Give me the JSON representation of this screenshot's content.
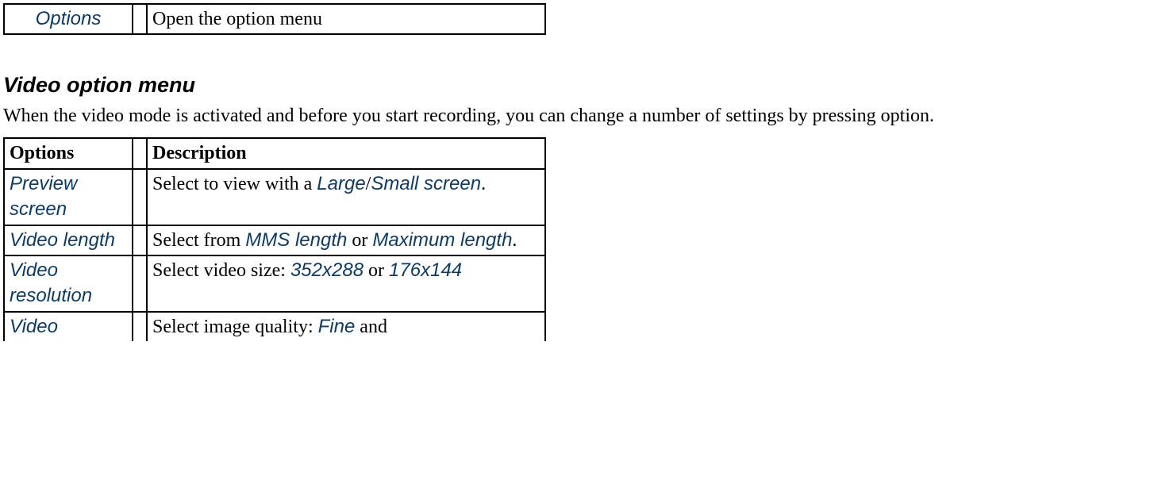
{
  "top_row": {
    "option": "Options",
    "desc": "Open the option menu"
  },
  "section_title": "Video option menu",
  "intro_pt1": "When the video mode is activated and before you start recording, you can change a number of settings by pressing ",
  "intro_pt2": " option.",
  "table_headers": {
    "c1": "Options",
    "c2": "Description"
  },
  "rows": {
    "preview": {
      "name": "Preview screen",
      "d_pre": "Select to view with a ",
      "d_kw1": "Large",
      "d_sep": "/",
      "d_kw2": "Small screen",
      "d_post": "."
    },
    "length": {
      "name": "Video length",
      "d_pre": "Select from ",
      "d_kw1": "MMS length",
      "d_mid": " or ",
      "d_kw2": "Maximum length",
      "d_post": "."
    },
    "resolution": {
      "name": "Video resolution",
      "d_pre": "Select video size: ",
      "d_kw1": "352x288",
      "d_mid": " or ",
      "d_kw2": "176x144"
    },
    "quality": {
      "name": "Video",
      "d_pre": "Select image quality: ",
      "d_kw1": "Fine",
      "d_mid": " and"
    }
  }
}
